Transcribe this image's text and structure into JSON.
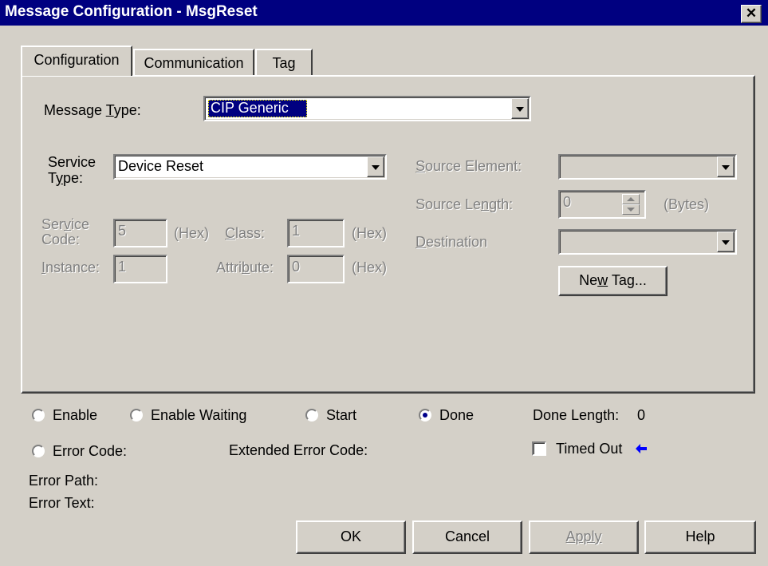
{
  "window": {
    "title": "Message Configuration - MsgReset",
    "close_glyph": "✕"
  },
  "tabs": [
    {
      "label": "Configuration",
      "active": true
    },
    {
      "label": "Communication",
      "active": false
    },
    {
      "label": "Tag",
      "active": false
    }
  ],
  "config": {
    "message_type_label_pre": "Message ",
    "message_type_label_key": "T",
    "message_type_label_post": "ype:",
    "message_type_value": "CIP Generic",
    "service_type_label_line1": "Service",
    "service_type_label_line2_pre": "T",
    "service_type_label_line2_key": "y",
    "service_type_label_line2_post": "pe:",
    "service_type_value": "Device Reset",
    "service_code_label_line1_pre": "Ser",
    "service_code_label_line1_key": "v",
    "service_code_label_line1_post": "ice",
    "service_code_label_line2": "Code:",
    "service_code_value": "5",
    "hex_unit": "(Hex)",
    "class_label_key": "C",
    "class_label_post": "lass:",
    "class_value": "1",
    "instance_label_key": "I",
    "instance_label_post": "nstance:",
    "instance_value": "1",
    "attribute_label_pre": "Attri",
    "attribute_label_key": "b",
    "attribute_label_post": "ute:",
    "attribute_value": "0",
    "source_element_label_key": "S",
    "source_element_label_post": "ource Element:",
    "source_element_value": "",
    "source_length_label_pre": "Source Le",
    "source_length_label_key": "n",
    "source_length_label_post": "gth:",
    "source_length_value": "0",
    "bytes_unit": "(Bytes)",
    "destination_label_key": "D",
    "destination_label_post": "estination",
    "destination_value": "",
    "new_tag_pre": "Ne",
    "new_tag_key": "w",
    "new_tag_post": " Tag..."
  },
  "status": {
    "enable": {
      "label": "Enable",
      "selected": false
    },
    "enable_waiting": {
      "label": "Enable Waiting",
      "selected": false
    },
    "start": {
      "label": "Start",
      "selected": false
    },
    "done": {
      "label": "Done",
      "selected": true
    },
    "done_length_label": "Done Length:",
    "done_length_value": "0",
    "error_code_label": "Error Code:",
    "extended_error_code_label": "Extended Error Code:",
    "timed_out_label": "Timed Out",
    "timed_out_checked": false,
    "error_path_label": "Error Path:",
    "error_text_label": "Error Text:"
  },
  "buttons": {
    "ok": "OK",
    "cancel": "Cancel",
    "apply": "Apply",
    "help": "Help"
  },
  "colors": {
    "title_bar": "#000080",
    "face": "#d4d0c8",
    "selection": "#000080",
    "arrow": "#0000ff"
  }
}
